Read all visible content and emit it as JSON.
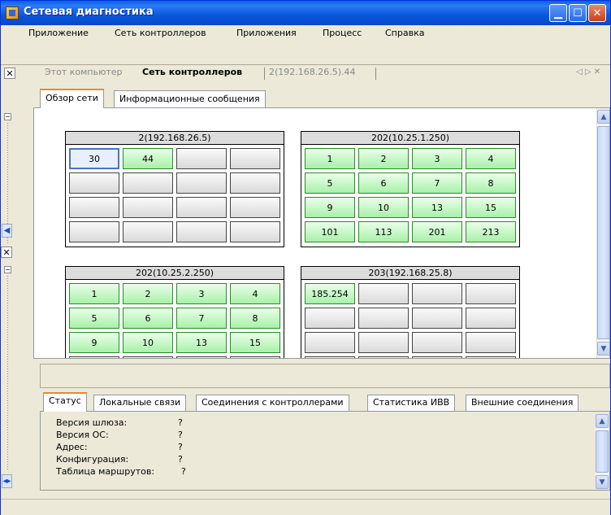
{
  "window": {
    "title": "Сетевая диагностика"
  },
  "menu": [
    "Приложение",
    "Сеть контроллеров",
    "Приложения",
    "Процесс",
    "Справка"
  ],
  "doc_tabs": [
    {
      "label": "Этот компьютер",
      "state": "inactive"
    },
    {
      "label": "Сеть контроллеров",
      "state": "active"
    },
    {
      "label": "2(192.168.26.5).44",
      "state": "inactive"
    }
  ],
  "inner_tabs": [
    "Обзор сети",
    "Информационные сообщения"
  ],
  "groups": [
    {
      "title": "2(192.168.26.5)",
      "cells": [
        "30",
        "44",
        "",
        "",
        "",
        "",
        "",
        "",
        "",
        "",
        "",
        "",
        "",
        "",
        "",
        ""
      ]
    },
    {
      "title": "202(10.25.1.250)",
      "cells": [
        "1",
        "2",
        "3",
        "4",
        "5",
        "6",
        "7",
        "8",
        "9",
        "10",
        "13",
        "15",
        "101",
        "113",
        "201",
        "213"
      ]
    },
    {
      "title": "202(10.25.2.250)",
      "cells": [
        "1",
        "2",
        "3",
        "4",
        "5",
        "6",
        "7",
        "8",
        "9",
        "10",
        "13",
        "15",
        "",
        "",
        "",
        ""
      ]
    },
    {
      "title": "203(192.168.25.8)",
      "cells": [
        "185.254",
        "",
        "",
        "",
        "",
        "",
        "",
        "",
        "",
        "",
        "",
        "",
        "",
        "",
        "",
        ""
      ]
    }
  ],
  "status_tabs": [
    "Статус",
    "Локальные связи",
    "Соединения с контроллерами",
    "Статистика ИВВ",
    "Внешние соединения"
  ],
  "status_rows": [
    {
      "label": "Версия шлюза:",
      "value": "?"
    },
    {
      "label": "Версия ОС:",
      "value": "?"
    },
    {
      "label": "Адрес:",
      "value": "?"
    },
    {
      "label": "Конфигурация:",
      "value": "?"
    },
    {
      "label": "Таблица маршрутов:",
      "value": "?"
    }
  ],
  "colors": {
    "title_bar": "#0a56dd",
    "online_cell": "#a8f0a8",
    "active_tab_accent": "#e68b2c"
  }
}
